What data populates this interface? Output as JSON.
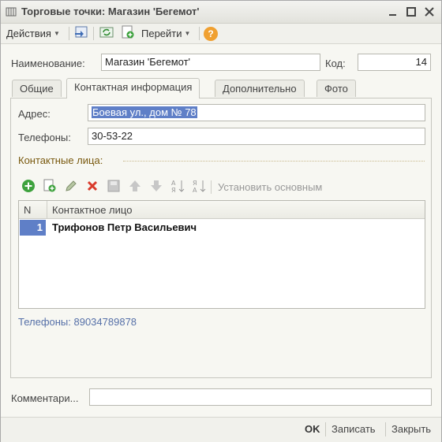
{
  "window": {
    "title": "Торговые точки: Магазин 'Бегемот'"
  },
  "toolbar": {
    "actions_label": "Действия",
    "goto_label": "Перейти",
    "help_label": "?"
  },
  "form": {
    "name_label": "Наименование:",
    "name_value": "Магазин 'Бегемот'",
    "code_label": "Код:",
    "code_value": "14"
  },
  "tabs": [
    {
      "label": "Общие"
    },
    {
      "label": "Контактная информация"
    },
    {
      "label": "Дополнительно"
    },
    {
      "label": "Фото"
    }
  ],
  "contact": {
    "address_label": "Адрес:",
    "address_value": "Боевая ул., дом № 78",
    "phones_label": "Телефоны:",
    "phones_value": "30-53-22",
    "section_title": "Контактные лица:",
    "set_main_label": "Установить основным",
    "table": {
      "columns": [
        "N",
        "Контактное лицо"
      ],
      "rows": [
        {
          "n": "1",
          "name": "Трифонов Петр Васильевич"
        }
      ]
    },
    "phone_link": "Телефоны: 89034789878"
  },
  "comment": {
    "label": "Комментари...",
    "value": ""
  },
  "bottom": {
    "ok_label": "OK",
    "save_label": "Записать",
    "close_label": "Закрыть"
  },
  "colors": {
    "selection": "#5f7fc7",
    "section_title": "#7a5a10",
    "link": "#5670a8"
  }
}
